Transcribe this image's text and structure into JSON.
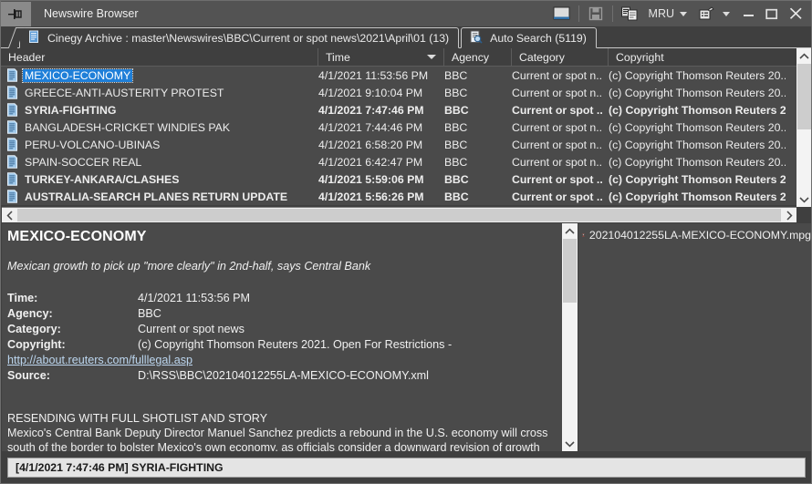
{
  "window": {
    "title": "Newswire Browser",
    "icon": "pin-icon"
  },
  "toolbar": {
    "preview_icon": "preview-pane-icon",
    "save_icon": "save-icon",
    "copy_icon": "copy-icon",
    "mru_label": "MRU",
    "settings_icon": "settings-icon",
    "minimize_label": "—",
    "maximize_label": "❐",
    "close_label": "✕"
  },
  "tabs": [
    {
      "id": "archive",
      "label": "Cinegy Archive : master\\Newswires\\BBC\\Current or spot news\\2021\\April\\01 (13)",
      "icon": "archive-icon",
      "active": true
    },
    {
      "id": "autosearch",
      "label": "Auto Search (5119)",
      "icon": "search-doc-icon",
      "active": false
    }
  ],
  "columns": [
    {
      "label": "Header",
      "sorted": false
    },
    {
      "label": "Time",
      "sorted": true
    },
    {
      "label": "Agency",
      "sorted": false
    },
    {
      "label": "Category",
      "sorted": false
    },
    {
      "label": "Copyright",
      "sorted": false
    }
  ],
  "rows": [
    {
      "header": "MEXICO-ECONOMY",
      "time": "4/1/2021 11:53:56 PM",
      "agency": "BBC",
      "category": "Current or spot n...",
      "copyright": "(c) Copyright Thomson Reuters 20...",
      "unread": false,
      "selected": true
    },
    {
      "header": "GREECE-ANTI-AUSTERITY PROTEST",
      "time": "4/1/2021 9:10:04 PM",
      "agency": "BBC",
      "category": "Current or spot n...",
      "copyright": "(c) Copyright Thomson Reuters 20...",
      "unread": false,
      "selected": false
    },
    {
      "header": "SYRIA-FIGHTING",
      "time": "4/1/2021 7:47:46 PM",
      "agency": "BBC",
      "category": "Current or spot ...",
      "copyright": "(c) Copyright Thomson Reuters 2...",
      "unread": true,
      "selected": false
    },
    {
      "header": "BANGLADESH-CRICKET WINDIES PAK",
      "time": "4/1/2021 7:44:46 PM",
      "agency": "BBC",
      "category": "Current or spot n...",
      "copyright": "(c) Copyright Thomson Reuters 20...",
      "unread": false,
      "selected": false
    },
    {
      "header": "PERU-VOLCANO-UBINAS",
      "time": "4/1/2021 6:58:20 PM",
      "agency": "BBC",
      "category": "Current or spot n...",
      "copyright": "(c) Copyright Thomson Reuters 20...",
      "unread": false,
      "selected": false
    },
    {
      "header": "SPAIN-SOCCER REAL",
      "time": "4/1/2021 6:42:47 PM",
      "agency": "BBC",
      "category": "Current or spot n...",
      "copyright": "(c) Copyright Thomson Reuters 20...",
      "unread": false,
      "selected": false
    },
    {
      "header": "TURKEY-ANKARA/CLASHES",
      "time": "4/1/2021 5:59:06 PM",
      "agency": "BBC",
      "category": "Current or spot ...",
      "copyright": "(c) Copyright Thomson Reuters 2...",
      "unread": true,
      "selected": false
    },
    {
      "header": "AUSTRALIA-SEARCH PLANES RETURN UPDATE",
      "time": "4/1/2021 5:56:26 PM",
      "agency": "BBC",
      "category": "Current or spot ...",
      "copyright": "(c) Copyright Thomson Reuters 2...",
      "unread": true,
      "selected": false
    }
  ],
  "detail": {
    "title": "MEXICO-ECONOMY",
    "subtitle": "Mexican growth to pick up \"more clearly\" in 2nd-half, says Central Bank",
    "fields": [
      {
        "key": "Time:",
        "value": "4/1/2021 11:53:56 PM"
      },
      {
        "key": "Agency:",
        "value": "BBC"
      },
      {
        "key": "Category:",
        "value": "Current or spot news"
      },
      {
        "key": "Copyright:",
        "value": "(c) Copyright Thomson Reuters 2021. Open For Restrictions -"
      }
    ],
    "link": "http://about.reuters.com/fulllegal.asp",
    "source_key": "Source:",
    "source_value": "D:\\RSS\\BBC\\202104012255LA-MEXICO-ECONOMY.xml",
    "body_line1": "RESENDING WITH FULL SHOTLIST AND STORY",
    "body_line2": "Mexico's Central Bank Deputy Director Manuel Sanchez predicts a rebound in the U.S. economy will cross",
    "body_line3": "south of the border to bolster Mexico's own economy, as officials consider a downward revision of growth"
  },
  "attachments": [
    {
      "name": "202104012255LA-MEXICO-ECONOMY.mpg",
      "icon": "hourglass-icon"
    }
  ],
  "statusbar": {
    "text": "[4/1/2021 7:47:46 PM] SYRIA-FIGHTING"
  },
  "colors": {
    "window_bg": "#3f3f3f",
    "list_bg": "#4a4a4a",
    "titlebar_bg": "#535353",
    "selection": "#1f7fd8",
    "text": "#ededed",
    "link": "#bcd6ef",
    "scrollbar_track": "#f3f3f3",
    "scrollbar_thumb": "#cdcdcd"
  }
}
